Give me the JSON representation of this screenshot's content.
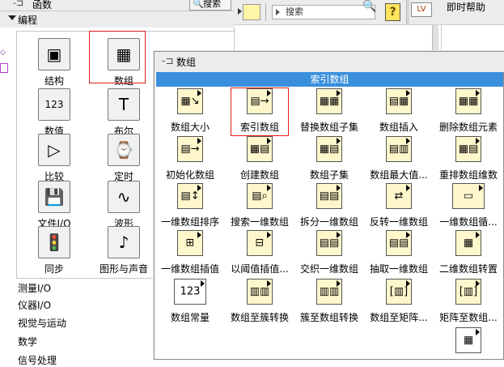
{
  "functions_palette": {
    "title": "函数",
    "search_label": "搜索",
    "subheader": "编程",
    "items": [
      {
        "label": "结构",
        "icon": "structures-icon",
        "glyph": "▣"
      },
      {
        "label": "数组",
        "icon": "array-icon",
        "glyph": "▦"
      },
      {
        "label": "数值",
        "icon": "numeric-icon",
        "glyph": "123"
      },
      {
        "label": "布尔",
        "icon": "boolean-icon",
        "glyph": "T"
      },
      {
        "label": "比较",
        "icon": "comparison-icon",
        "glyph": "▷"
      },
      {
        "label": "定时",
        "icon": "timing-icon",
        "glyph": "⌚"
      },
      {
        "label": "文件I/O",
        "icon": "file-io-icon",
        "glyph": "💾"
      },
      {
        "label": "波形",
        "icon": "waveform-icon",
        "glyph": "∿"
      },
      {
        "label": "同步",
        "icon": "synchronization-icon",
        "glyph": "🚦"
      },
      {
        "label": "图形与声音",
        "icon": "graphics-sound-icon",
        "glyph": "♪"
      }
    ],
    "categories": [
      "测量I/O",
      "仪器I/O",
      "视觉与运动",
      "数学",
      "信号处理"
    ]
  },
  "toolbar": {
    "search_placeholder": "搜索",
    "help_label": "即时帮助",
    "lv_label": "LV"
  },
  "array_palette": {
    "title": "数组",
    "highlight": "索引数组",
    "items": [
      {
        "label": "数组大小",
        "icon": "array-size-icon",
        "glyph": "▦↘"
      },
      {
        "label": "索引数组",
        "icon": "index-array-icon",
        "glyph": "▤→"
      },
      {
        "label": "替换数组子集",
        "icon": "replace-array-subset-icon",
        "glyph": "▦▦"
      },
      {
        "label": "数组插入",
        "icon": "insert-into-array-icon",
        "glyph": "▤▦"
      },
      {
        "label": "删除数组元素",
        "icon": "delete-from-array-icon",
        "glyph": "▦▦"
      },
      {
        "label": "初始化数组",
        "icon": "initialize-array-icon",
        "glyph": "▤→"
      },
      {
        "label": "创建数组",
        "icon": "build-array-icon",
        "glyph": "▦▤"
      },
      {
        "label": "数组子集",
        "icon": "array-subset-icon",
        "glyph": "▦▤"
      },
      {
        "label": "数组最大值...",
        "icon": "array-max-min-icon",
        "glyph": "▤▥"
      },
      {
        "label": "重排数组维数",
        "icon": "reshape-array-icon",
        "glyph": "▦▤"
      },
      {
        "label": "一维数组排序",
        "icon": "sort-1d-array-icon",
        "glyph": "▤↕"
      },
      {
        "label": "搜索一维数组",
        "icon": "search-1d-array-icon",
        "glyph": "▤⌕"
      },
      {
        "label": "拆分一维数组",
        "icon": "split-1d-array-icon",
        "glyph": "▤▤"
      },
      {
        "label": "反转一维数组",
        "icon": "reverse-1d-array-icon",
        "glyph": "⇄"
      },
      {
        "label": "一维数组循...",
        "icon": "rotate-1d-array-icon",
        "glyph": "▭"
      },
      {
        "label": "一维数组插值",
        "icon": "interpolate-1d-array-icon",
        "glyph": "⊞"
      },
      {
        "label": "以阈值插值...",
        "icon": "threshold-1d-array-icon",
        "glyph": "⊟"
      },
      {
        "label": "交织一维数组",
        "icon": "interleave-1d-arrays-icon",
        "glyph": "▤▤"
      },
      {
        "label": "抽取一维数组",
        "icon": "decimate-1d-array-icon",
        "glyph": "▤▤"
      },
      {
        "label": "二维数组转置",
        "icon": "transpose-2d-array-icon",
        "glyph": "▦"
      },
      {
        "label": "数组常量",
        "icon": "array-constant-icon",
        "glyph": "123"
      },
      {
        "label": "数组至簇转换",
        "icon": "array-to-cluster-icon",
        "glyph": "▥▥"
      },
      {
        "label": "簇至数组转换",
        "icon": "cluster-to-array-icon",
        "glyph": "▥▥"
      },
      {
        "label": "数组至矩阵...",
        "icon": "array-to-matrix-icon",
        "glyph": "[▥]"
      },
      {
        "label": "矩阵至数组...",
        "icon": "matrix-to-array-icon",
        "glyph": "[▥]"
      },
      {
        "label": "",
        "icon": "more-array-icon",
        "glyph": "▦"
      }
    ]
  }
}
